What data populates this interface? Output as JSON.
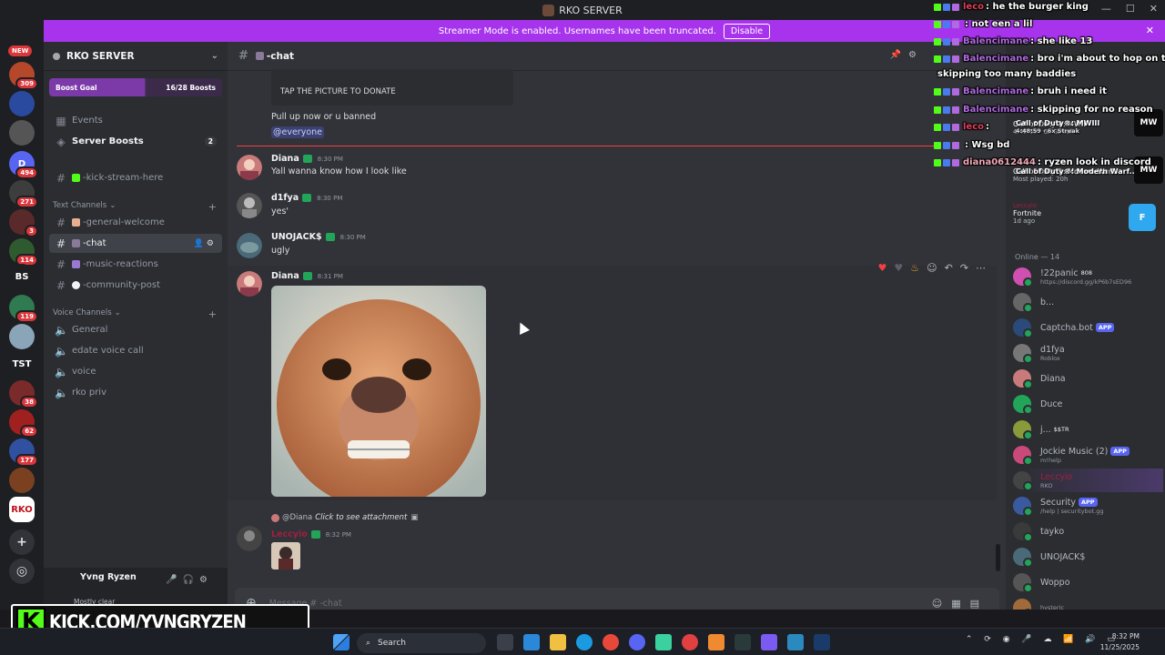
{
  "window": {
    "title": "RKO SERVER"
  },
  "banner": {
    "text": "Streamer Mode is enabled. Usernames have been truncated.",
    "button": "Disable"
  },
  "rail": {
    "new_label": "NEW",
    "servers": [
      {
        "label": "",
        "badge": "309",
        "color": "#b5472b"
      },
      {
        "label": "",
        "badge": "",
        "color": "#2a4aa0"
      },
      {
        "label": "",
        "badge": "",
        "color": "#555555"
      },
      {
        "label": "D",
        "badge": "494",
        "color": "#5865f2"
      },
      {
        "label": "",
        "badge": "271",
        "color": "#3d3d3d"
      },
      {
        "label": "",
        "badge": "3",
        "color": "#5a2a2a"
      },
      {
        "label": "",
        "badge": "114",
        "color": "#2f5a30"
      },
      {
        "label": "BS",
        "badge": "",
        "color": "#1e1f22"
      },
      {
        "label": "",
        "badge": "119",
        "color": "#2f7a50"
      },
      {
        "label": "",
        "badge": "",
        "color": "#8aa4b8"
      },
      {
        "label": "TST",
        "badge": "",
        "color": "#1e1f22"
      },
      {
        "label": "",
        "badge": "38",
        "color": "#7a2a2a"
      },
      {
        "label": "",
        "badge": "62",
        "color": "#a02020"
      },
      {
        "label": "",
        "badge": "177",
        "color": "#3050a0"
      },
      {
        "label": "",
        "badge": "",
        "color": "#7a4020"
      },
      {
        "label": "RKO",
        "badge": "",
        "color": "#ffffff"
      }
    ]
  },
  "sidebar": {
    "server_name": "RKO SERVER",
    "boost_goal": "Boost Goal",
    "boost_count": "16/28 Boosts",
    "events": "Events",
    "server_boosts": "Server Boosts",
    "server_boosts_count": "2",
    "kick_channel": "-kick-stream-here",
    "text_category": "Text Channels",
    "text_channels": [
      "-general-welcome",
      "-chat",
      "-music-reactions",
      "-community-post"
    ],
    "voice_category": "Voice Channels",
    "voice_channels": [
      "General",
      "edate voice call",
      "voice",
      "rko priv"
    ],
    "user": {
      "name": "Yvng Ryzen",
      "status": "Mostly clear"
    }
  },
  "kick_overlay": {
    "logo": "K",
    "text": "KICK.COM/YVNGRYZEN"
  },
  "chat": {
    "channel": "-chat",
    "embed_text": "TAP THE PICTURE TO DONATE",
    "pinned_line": "Pull up now or u banned",
    "mention": "@everyone",
    "messages": [
      {
        "author": "Diana",
        "time": "8:30 PM",
        "text": "Yall wanna know how I look like",
        "avatar": "#c97a7a"
      },
      {
        "author": "d1fya",
        "time": "8:30 PM",
        "text": "yes'",
        "avatar": "#777777"
      },
      {
        "author": "UNOJACK$",
        "time": "8:30 PM",
        "text": "ugly",
        "avatar": "#4a6a7a"
      },
      {
        "author": "Diana",
        "time": "8:31 PM",
        "text": "",
        "avatar": "#c97a7a"
      }
    ],
    "reply": {
      "to": "@Diana",
      "text": "Click to see attachment"
    },
    "last_author": "Leccyio",
    "last_time": "8:32 PM",
    "composer_placeholder": "Message #  -chat"
  },
  "members": {
    "activity": [
      {
        "title": "Call of Duty®: MWIII",
        "sub": "4:48:59 · 6x Streak",
        "icon": "MW"
      },
      {
        "title": "Call of Duty®: Modern Warf...",
        "sub": "Most played: 20h",
        "icon": "MW"
      },
      {
        "name": "Leccyio",
        "title": "Fortnite",
        "sub": "1d ago",
        "icon": "F"
      }
    ],
    "online_header": "Online — 14",
    "list": [
      {
        "name": "!22panic",
        "tag": "808",
        "sub": "https://discord.gg/kP6b7sED96",
        "color": "#d14fb0",
        "app": false
      },
      {
        "name": "b...",
        "tag": "",
        "sub": "",
        "color": "#666666",
        "app": false
      },
      {
        "name": "Captcha.bot",
        "tag": "",
        "sub": "",
        "color": "#2b4a7a",
        "app": true
      },
      {
        "name": "d1fya",
        "tag": "",
        "sub": "Roblox",
        "color": "#777777",
        "app": false
      },
      {
        "name": "Diana",
        "tag": "",
        "sub": "",
        "color": "#c97a7a",
        "app": false
      },
      {
        "name": "Duce",
        "tag": "",
        "sub": "",
        "color": "#23a559",
        "app": false
      },
      {
        "name": "j...",
        "tag": "$$TR",
        "sub": "",
        "color": "#8a9a3a",
        "app": false
      },
      {
        "name": "Jockie Music (2)",
        "tag": "",
        "sub": "m!help",
        "color": "#c94a7a",
        "app": true
      },
      {
        "name": "Leccyio",
        "tag": "",
        "sub": "RKO",
        "color": "#444444",
        "app": false
      },
      {
        "name": "Security",
        "tag": "",
        "sub": "/help | securitybot.gg",
        "color": "#3a5aa0",
        "app": true
      },
      {
        "name": "tayko",
        "tag": "",
        "sub": "",
        "color": "#3a3a3a",
        "app": false
      },
      {
        "name": "UNOJACK$",
        "tag": "",
        "sub": "",
        "color": "#4a6a7a",
        "app": false
      },
      {
        "name": "Woppo",
        "tag": "",
        "sub": "",
        "color": "#555555",
        "app": false
      },
      {
        "name": "",
        "tag": "",
        "sub": "hysteric",
        "color": "#a06a3a",
        "app": false
      }
    ],
    "app_label": "APP"
  },
  "stream_chat": [
    {
      "user": "leco",
      "color": "#e0405a",
      "text": ": he the burger king"
    },
    {
      "user": "",
      "color": "#e0405a",
      "text": ": not een a lil"
    },
    {
      "user": "Balencimane",
      "color": "#b06ae0",
      "text": ": she like 13"
    },
    {
      "user": "Balencimane",
      "color": "#b06ae0",
      "text": ": bro i'm about to hop on ts you"
    },
    {
      "user": "",
      "color": "#ffffff",
      "text": "skipping too many baddies"
    },
    {
      "user": "Balencimane",
      "color": "#b06ae0",
      "text": ": bruh i need it"
    },
    {
      "user": "Balencimane",
      "color": "#b06ae0",
      "text": ": skipping for no reason"
    },
    {
      "user": "leco",
      "color": "#e0405a",
      "text": ":"
    },
    {
      "user": "",
      "color": "#e0405a",
      "text": ": Wsg bd"
    },
    {
      "user": "diana0612444",
      "color": "#f2a8b8",
      "text": ": ryzen look in discord"
    }
  ],
  "taskbar": {
    "search": "Search",
    "time": "8:32 PM",
    "date": "11/25/2025"
  }
}
